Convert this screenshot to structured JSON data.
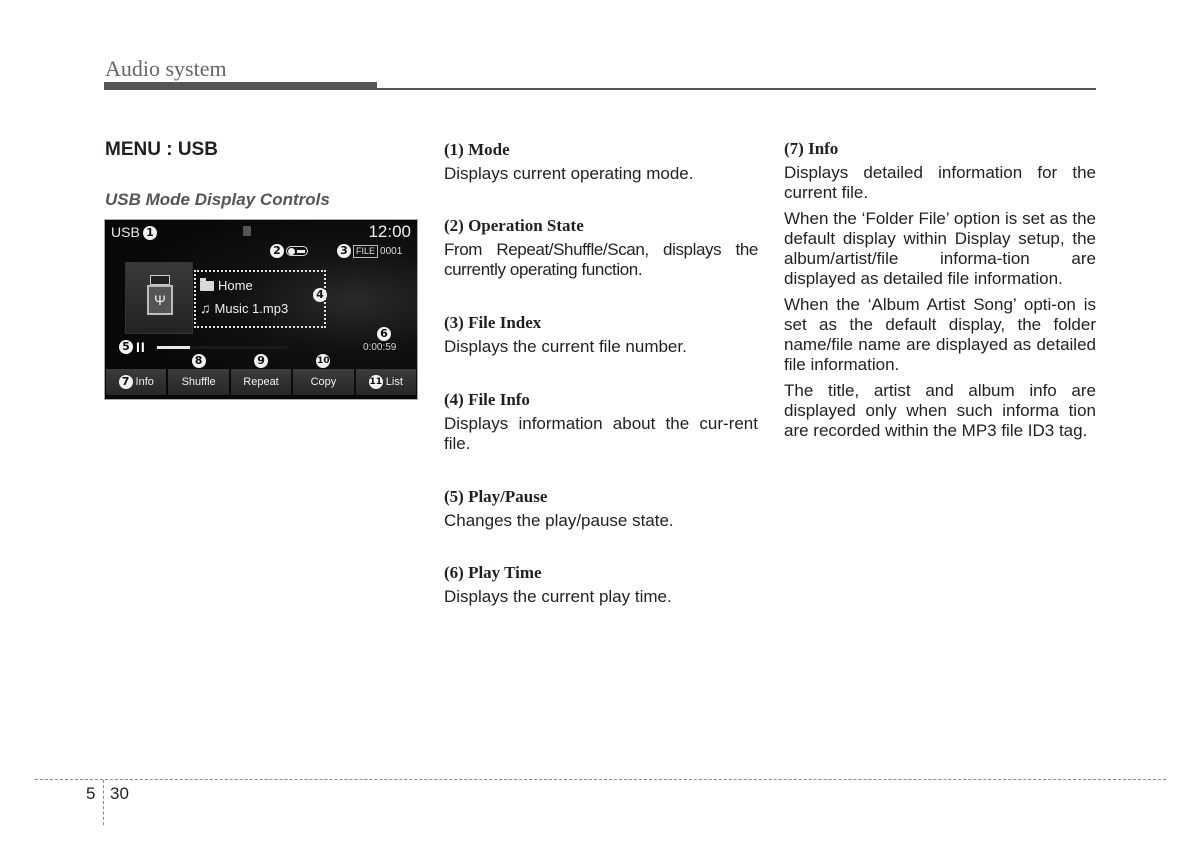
{
  "header": {
    "section_title": "Audio system"
  },
  "left": {
    "menu_title": "MENU : USB",
    "subtitle": "USB Mode Display Controls",
    "screen": {
      "mode_label": "USB",
      "clock": "12:00",
      "file_tag": "FILE",
      "file_index": "0001",
      "folder_name": "Home",
      "file_name": "Music 1.mp3",
      "pause_glyph": "II",
      "play_time": "0:00:59",
      "progress_fraction": 0.25,
      "usb_glyph": "Ψ",
      "callouts": [
        "1",
        "2",
        "3",
        "4",
        "5",
        "6",
        "7",
        "8",
        "9",
        "10",
        "11"
      ],
      "softkeys": [
        {
          "label": "Info",
          "callout": "7"
        },
        {
          "label": "Shuffle",
          "callout": "8"
        },
        {
          "label": "Repeat",
          "callout": "9"
        },
        {
          "label": "Copy",
          "callout": "10"
        },
        {
          "label": "List",
          "callout": "11"
        }
      ]
    }
  },
  "middle": [
    {
      "heading": "(1) Mode",
      "paragraphs": [
        "Displays current operating mode."
      ]
    },
    {
      "heading": "(2) Operation State",
      "paragraphs": [
        "From Repeat/Shuffle/Scan, displays the currently operating function."
      ]
    },
    {
      "heading": "(3) File Index",
      "paragraphs": [
        "Displays the current file number."
      ]
    },
    {
      "heading": "(4) File Info",
      "paragraphs": [
        "Displays information about the cur-rent file."
      ]
    },
    {
      "heading": "(5) Play/Pause",
      "paragraphs": [
        "Changes the play/pause state."
      ]
    },
    {
      "heading": "(6) Play Time",
      "paragraphs": [
        "Displays the current play time."
      ]
    }
  ],
  "right": [
    {
      "heading": "(7) Info",
      "paragraphs": [
        "Displays detailed information for the current file.",
        "When the ‘Folder File’ option is set as the default display within Display setup, the album/artist/file informa-tion are displayed as detailed file information.",
        "When the ‘Album Artist Song’ opti-on is set as the default display, the folder name/file name are displayed as detailed file information.",
        "The title, artist and album info are displayed only when such informa tion are recorded within the MP3 file ID3 tag."
      ]
    }
  ],
  "footer": {
    "chapter": "5",
    "page": "30"
  }
}
